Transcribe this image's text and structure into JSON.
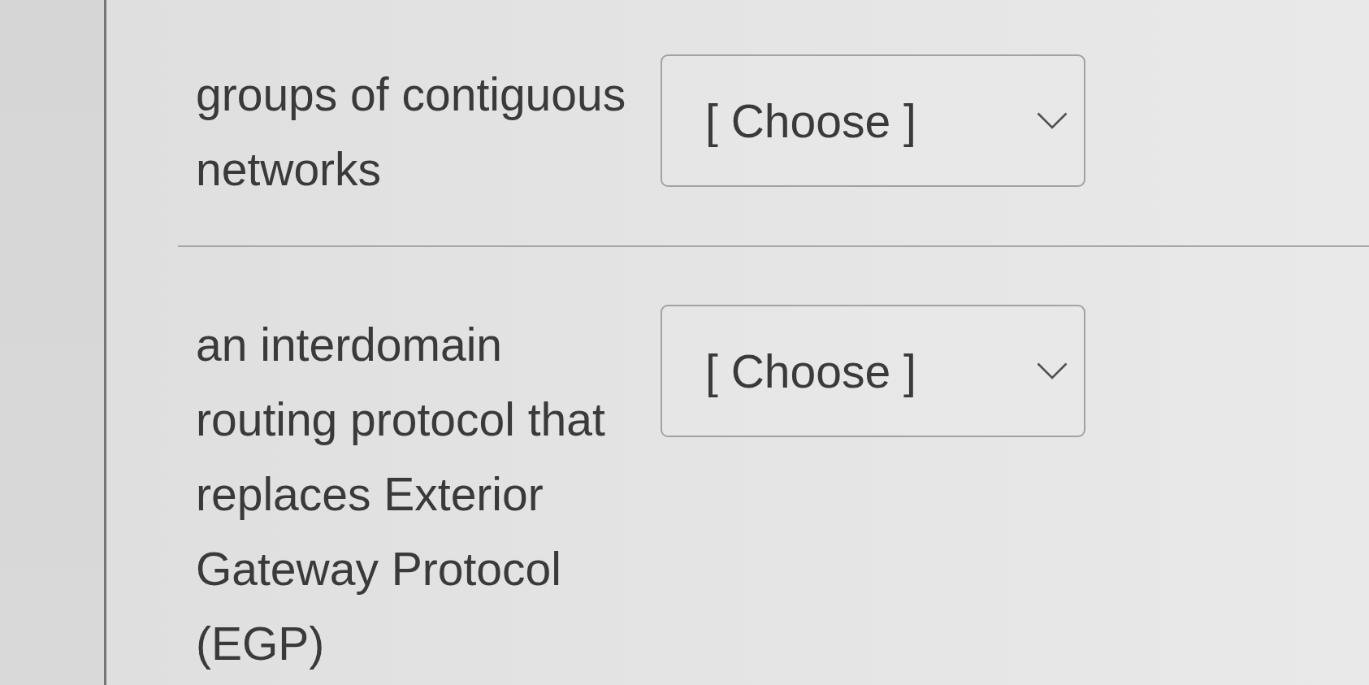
{
  "questions": [
    {
      "prompt": "groups of contiguous networks",
      "dropdown": {
        "value": "[ Choose ]"
      }
    },
    {
      "prompt": "an interdomain routing protocol that replaces Exterior Gateway Protocol (EGP)",
      "dropdown": {
        "value": "[ Choose ]"
      }
    }
  ]
}
